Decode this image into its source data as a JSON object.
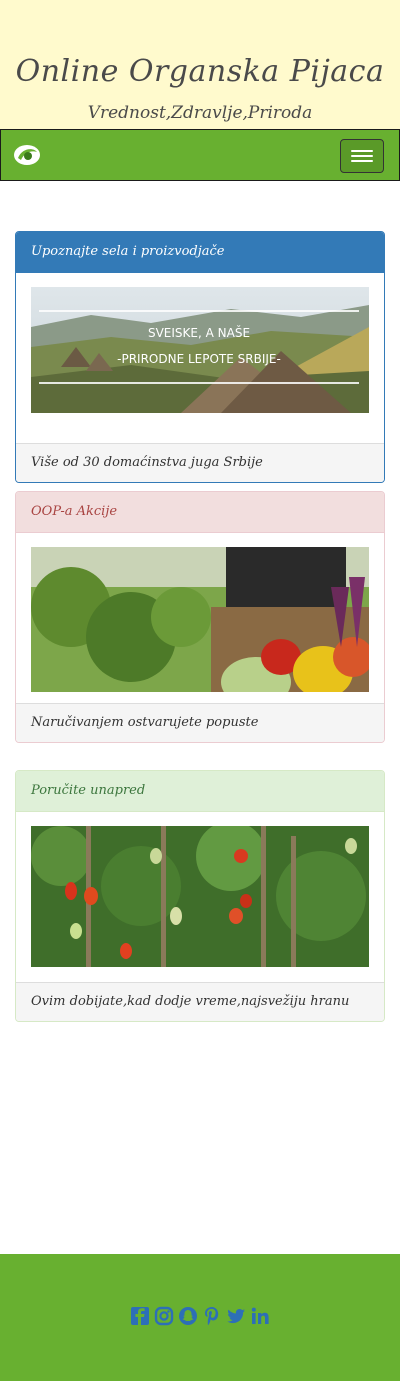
{
  "header": {
    "title": "Online Organska Pijaca",
    "subtitle": "Vrednost,Zdravlje,Priroda"
  },
  "navbar": {
    "logo_icon": "leaf-logo-icon",
    "toggle_icon": "hamburger-menu-icon"
  },
  "colors": {
    "navbar": "#68b030",
    "primary": "#337ab7",
    "danger_bg": "#f2dede",
    "success_bg": "#dff0d8"
  },
  "cards": [
    {
      "heading": "Upoznajte sela i proizvodjače",
      "banner_line1": "SVEISKE, A NAŠE",
      "banner_line2": "-PRIRODNE LEPOTE SRBIJE-",
      "footer": "Više od 30 domaćinstva juga Srbije"
    },
    {
      "heading": "OOP-a Akcije",
      "footer": "Naručivanjem ostvarujete popuste"
    },
    {
      "heading": "Poručite unapred",
      "footer": "Ovim dobijate,kad dodje vreme,najsvežiju hranu"
    }
  ],
  "footer": {
    "social_icons": [
      "facebook-icon",
      "instagram-icon",
      "snapchat-icon",
      "pinterest-icon",
      "twitter-icon",
      "linkedin-icon"
    ]
  }
}
